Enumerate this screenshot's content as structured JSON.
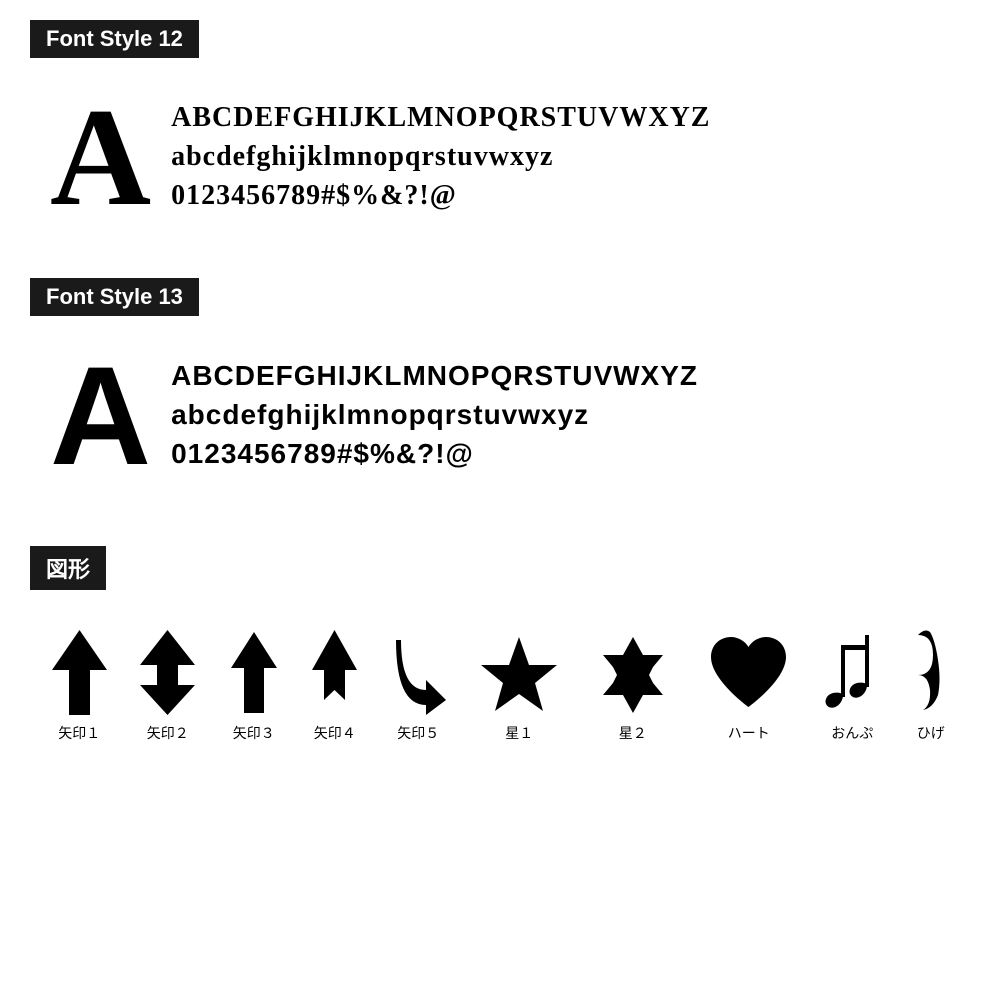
{
  "sections": {
    "style12": {
      "header": "Font Style 12",
      "bigLetter": "A",
      "lines": [
        "ABCDEFGHIJKLMNOPQRSTUVWXYZ",
        "abcdefghijklmnopqrstuvwxyz",
        "0123456789#$%&?!@"
      ]
    },
    "style13": {
      "header": "Font Style 13",
      "bigLetter": "A",
      "lines": [
        "ABCDEFGHIJKLMNOPQRSTUVWXYZ",
        "abcdefghijklmnopqrstuvwxyz",
        "0123456789#$%&?!@"
      ]
    },
    "shapes": {
      "header": "図形",
      "items": [
        {
          "label": "矢印１",
          "type": "arrow1"
        },
        {
          "label": "矢印２",
          "type": "arrow2"
        },
        {
          "label": "矢印３",
          "type": "arrow3"
        },
        {
          "label": "矢印４",
          "type": "arrow4"
        },
        {
          "label": "矢印５",
          "type": "arrow5"
        },
        {
          "label": "星１",
          "type": "star1"
        },
        {
          "label": "星２",
          "type": "star2"
        },
        {
          "label": "ハート",
          "type": "heart"
        },
        {
          "label": "おんぷ",
          "type": "note"
        },
        {
          "label": "ひげ",
          "type": "mustache"
        }
      ]
    }
  }
}
